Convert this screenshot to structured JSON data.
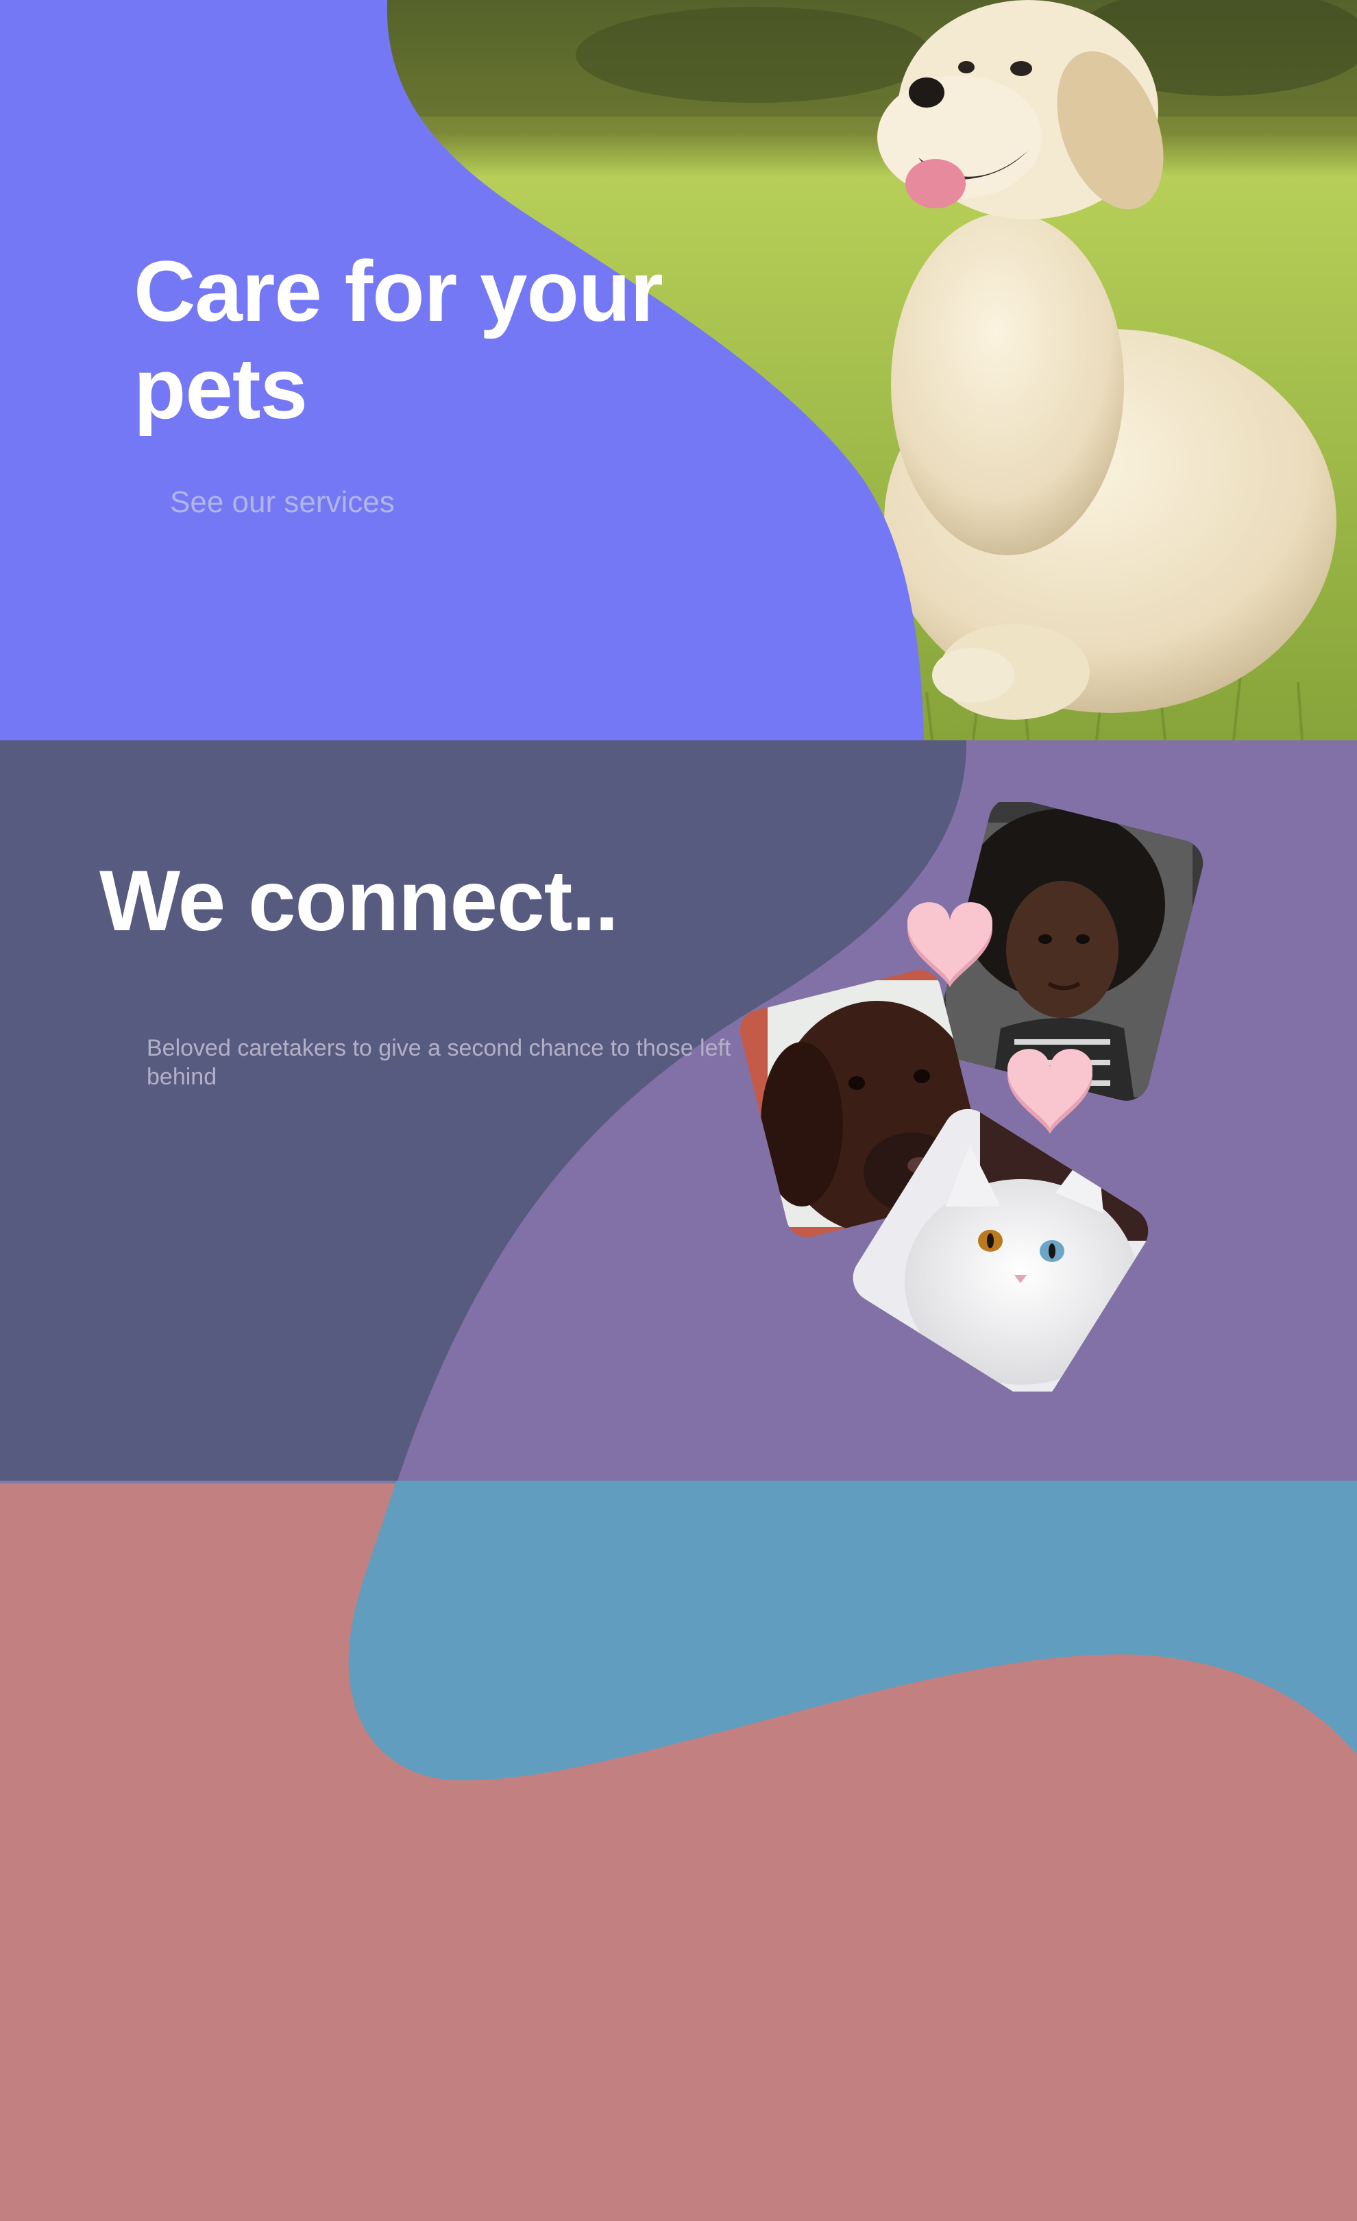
{
  "hero": {
    "title": "Care for your pets",
    "cta_label": "See our services"
  },
  "connect": {
    "title": "We connect..",
    "subtitle": "Beloved caretakers to give a second chance to those left behind"
  },
  "colors": {
    "hero_bg": "#7578f5",
    "connect_bg": "#585b80",
    "connect_accent": "#8271a6",
    "bottom_bg": "#c28180",
    "bottom_accent": "#609dbf",
    "heart": "#f9c6cf"
  }
}
